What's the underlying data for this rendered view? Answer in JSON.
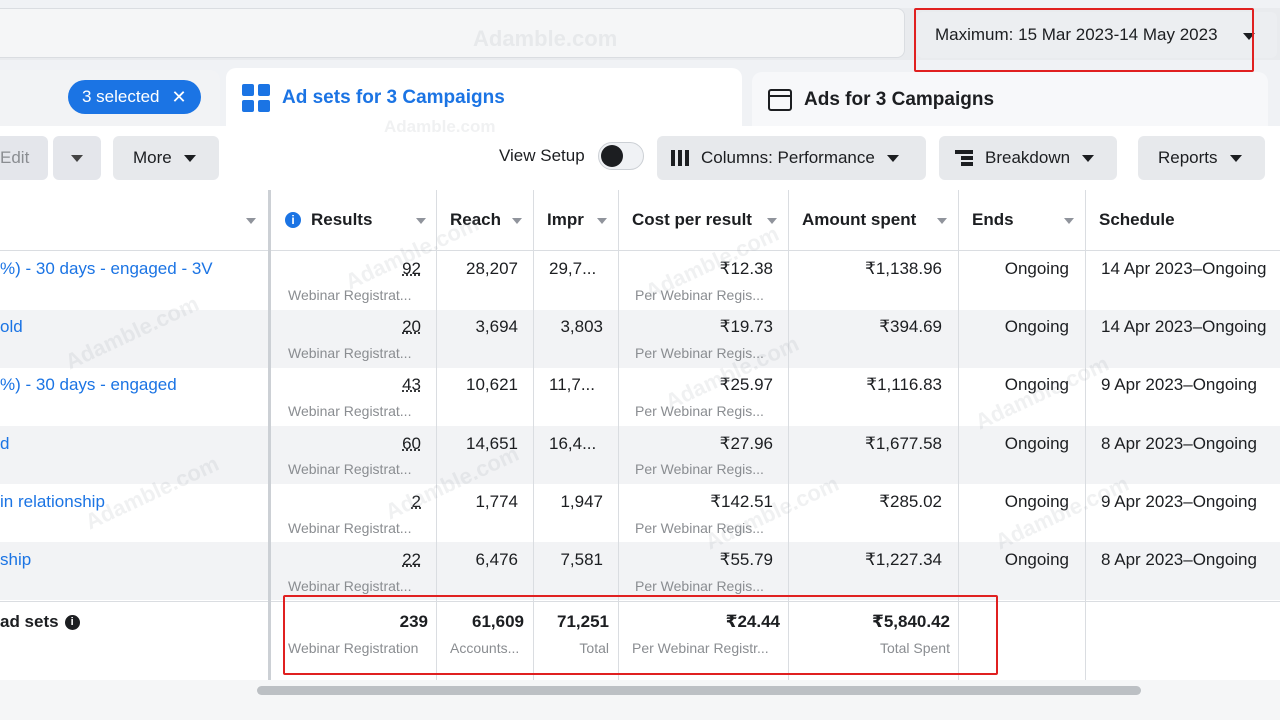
{
  "date_range": {
    "label": "Maximum: 15 Mar 2023-14 May 2023"
  },
  "tabs": {
    "campaigns_selected": "3 selected",
    "close_glyph": "✕",
    "ad_sets": "Ad sets for 3 Campaigns",
    "ads": "Ads for 3 Campaigns"
  },
  "toolbar": {
    "edit": "Edit",
    "more": "More",
    "view_setup": "View Setup",
    "columns": "Columns: Performance",
    "breakdown": "Breakdown",
    "reports": "Reports"
  },
  "table": {
    "headers": {
      "results": "Results",
      "reach": "Reach",
      "impressions": "Impr",
      "cost_per_result": "Cost per result",
      "amount_spent": "Amount spent",
      "ends": "Ends",
      "schedule": "Schedule"
    },
    "rows": [
      {
        "name": "%) - 30 days - engaged - 3V",
        "results": "92",
        "results_sub": "Webinar Registrat...",
        "reach": "28,207",
        "impressions": "29,7...",
        "cost": "₹12.38",
        "cost_sub": "Per Webinar Regis...",
        "spent": "₹1,138.96",
        "ends": "Ongoing",
        "schedule": "14 Apr 2023–Ongoing"
      },
      {
        "name": "old",
        "results": "20",
        "results_sub": "Webinar Registrat...",
        "reach": "3,694",
        "impressions": "3,803",
        "cost": "₹19.73",
        "cost_sub": "Per Webinar Regis...",
        "spent": "₹394.69",
        "ends": "Ongoing",
        "schedule": "14 Apr 2023–Ongoing"
      },
      {
        "name": "%) - 30 days - engaged",
        "results": "43",
        "results_sub": "Webinar Registrat...",
        "reach": "10,621",
        "impressions": "11,7...",
        "cost": "₹25.97",
        "cost_sub": "Per Webinar Regis...",
        "spent": "₹1,116.83",
        "ends": "Ongoing",
        "schedule": "9 Apr 2023–Ongoing"
      },
      {
        "name": "d",
        "results": "60",
        "results_sub": "Webinar Registrat...",
        "reach": "14,651",
        "impressions": "16,4...",
        "cost": "₹27.96",
        "cost_sub": "Per Webinar Regis...",
        "spent": "₹1,677.58",
        "ends": "Ongoing",
        "schedule": "8 Apr 2023–Ongoing"
      },
      {
        "name": "in relationship",
        "results": "2",
        "results_sub": "Webinar Registrat...",
        "reach": "1,774",
        "impressions": "1,947",
        "cost": "₹142.51",
        "cost_sub": "Per Webinar Regis...",
        "spent": "₹285.02",
        "ends": "Ongoing",
        "schedule": "9 Apr 2023–Ongoing"
      },
      {
        "name": "ship",
        "results": "22",
        "results_sub": "Webinar Registrat...",
        "reach": "6,476",
        "impressions": "7,581",
        "cost": "₹55.79",
        "cost_sub": "Per Webinar Regis...",
        "spent": "₹1,227.34",
        "ends": "Ongoing",
        "schedule": "8 Apr 2023–Ongoing"
      }
    ],
    "totals": {
      "label": "ad sets",
      "results": "239",
      "results_sub": "Webinar Registration",
      "reach": "61,609",
      "reach_sub": "Accounts...",
      "impressions": "71,251",
      "impressions_sub": "Total",
      "cost": "₹24.44",
      "cost_sub": "Per Webinar Registr...",
      "spent": "₹5,840.42",
      "spent_sub": "Total Spent"
    }
  },
  "watermark": "Adamble.com",
  "colors": {
    "accent": "#1b74e4",
    "highlight_box": "#e02020",
    "row_alt": "#f2f3f5"
  }
}
